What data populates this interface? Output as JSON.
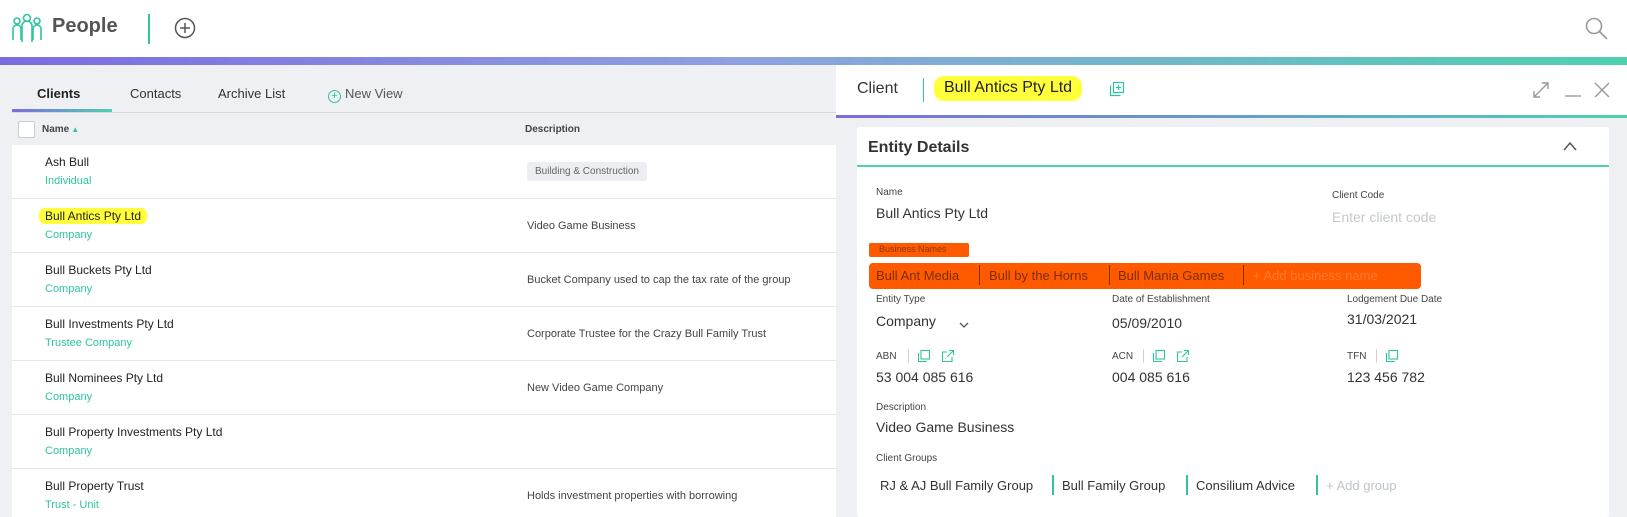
{
  "app": {
    "title": "People"
  },
  "colors": {
    "accent": "#2ec4a0",
    "purple": "#7b6be0",
    "highlight_yellow": "#ffff3c",
    "highlight_orange": "#ff5a00"
  },
  "icons": {
    "app": "people-icon",
    "add": "plus-circle-icon",
    "search": "search-icon",
    "copy": "copy-icon",
    "external": "external-link-icon",
    "expand": "expand-icon",
    "minimize": "minimize-icon",
    "close": "close-icon",
    "collapse": "chevron-up-icon",
    "dropdown": "chevron-down-icon"
  },
  "tabs": [
    {
      "label": "Clients",
      "active": true
    },
    {
      "label": "Contacts",
      "active": false
    },
    {
      "label": "Archive List",
      "active": false
    },
    {
      "label": "New View",
      "active": false
    }
  ],
  "table": {
    "columns": [
      "Name",
      "Description"
    ],
    "rows": [
      {
        "name": "Ash Bull",
        "type": "Individual",
        "description": "Building & Construction"
      },
      {
        "name": "Bull Antics Pty Ltd",
        "type": "Company",
        "description": "Video Game Business"
      },
      {
        "name": "Bull Buckets Pty Ltd",
        "type": "Company",
        "description": "Bucket Company used to cap the tax rate of the group"
      },
      {
        "name": "Bull Investments Pty Ltd",
        "type": "Trustee Company",
        "description": "Corporate Trustee for the Crazy Bull Family Trust"
      },
      {
        "name": "Bull Nominees Pty Ltd",
        "type": "Company",
        "description": "New Video Game Company"
      },
      {
        "name": "Bull Property Investments Pty Ltd",
        "type": "Company",
        "description": ""
      },
      {
        "name": "Bull Property Trust",
        "type": "Trust - Unit",
        "description": "Holds investment properties with borrowing"
      }
    ]
  },
  "detail": {
    "header_label": "Client",
    "client_name": "Bull Antics Pty Ltd",
    "section_title": "Entity Details",
    "fields": {
      "name_label": "Name",
      "name_value": "Bull Antics Pty Ltd",
      "client_code_label": "Client Code",
      "client_code_placeholder": "Enter client code",
      "business_names_label": "Business Names",
      "business_names": [
        "Bull Ant Media",
        "Bull by the Horns",
        "Bull Mania Games"
      ],
      "add_business_name": "+ Add business name",
      "entity_type_label": "Entity Type",
      "entity_type_value": "Company",
      "date_est_label": "Date of Establishment",
      "date_est_value": "05/09/2010",
      "lodgement_label": "Lodgement Due Date",
      "lodgement_value": "31/03/2021",
      "abn_label": "ABN",
      "abn_value": "53 004 085 616",
      "acn_label": "ACN",
      "acn_value": "004 085 616",
      "tfn_label": "TFN",
      "tfn_value": "123 456 782",
      "description_label": "Description",
      "description_value": "Video Game Business",
      "client_groups_label": "Client Groups",
      "client_groups": [
        "RJ & AJ Bull Family Group",
        "Bull Family Group",
        "Consilium Advice"
      ],
      "add_group": "+ Add group"
    }
  }
}
